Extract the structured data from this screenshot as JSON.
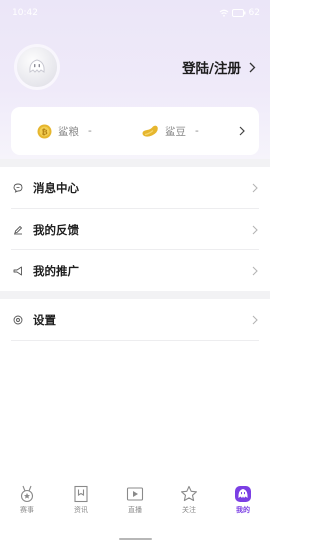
{
  "status": {
    "time": "10:42",
    "battery": "62"
  },
  "profile": {
    "login_label": "登陆/注册"
  },
  "assets": [
    {
      "name": "鲨粮",
      "value": "-",
      "icon": "coin-icon"
    },
    {
      "name": "鲨豆",
      "value": "-",
      "icon": "bean-icon"
    }
  ],
  "menu": {
    "messages": "消息中心",
    "feedback": "我的反馈",
    "promotion": "我的推广",
    "settings": "设置"
  },
  "tabs": [
    {
      "label": "赛事",
      "icon": "medal-icon"
    },
    {
      "label": "资讯",
      "icon": "bookmark-icon"
    },
    {
      "label": "直播",
      "icon": "play-icon"
    },
    {
      "label": "关注",
      "icon": "star-icon"
    },
    {
      "label": "我的",
      "icon": "shark-icon",
      "active": true
    }
  ],
  "colors": {
    "accent": "#7b3fe4",
    "header_bg": "#ece7f8",
    "gold": "#e6b62e"
  }
}
